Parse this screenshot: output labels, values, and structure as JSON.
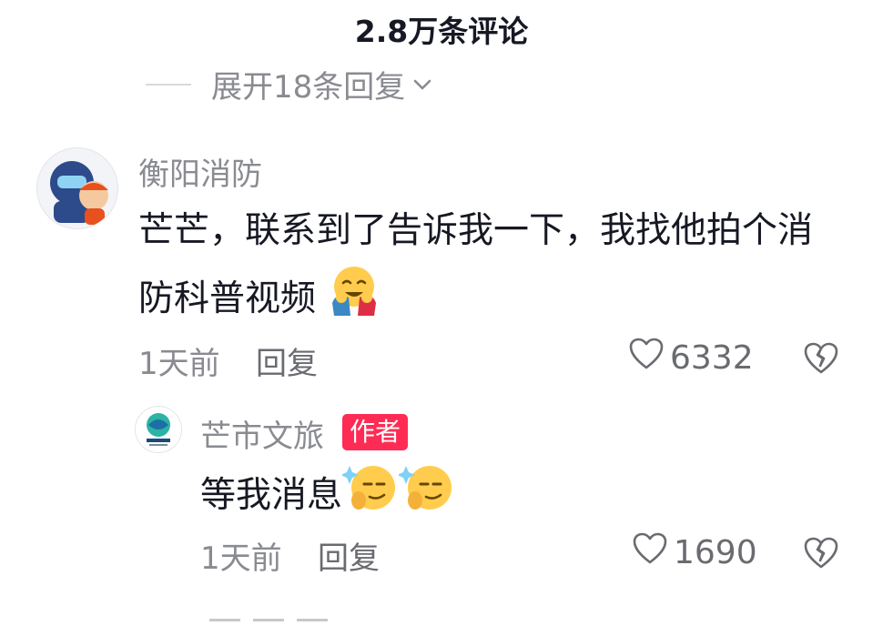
{
  "header": {
    "title": "2.8万条评论"
  },
  "expand": {
    "label": "展开18条回复"
  },
  "comments": [
    {
      "username": "衡阳消防",
      "text": "芒芒，联系到了告诉我一下，我找他拍个消防科普视频",
      "emoji": "hugging-face-emoji",
      "time": "1天前",
      "reply_label": "回复",
      "likes": "6332"
    },
    {
      "username": "芒市文旅",
      "badge": "作者",
      "text": "等我消息",
      "emoji": "smirk-sparkle-emoji",
      "time": "1天前",
      "reply_label": "回复",
      "likes": "1690"
    }
  ],
  "colors": {
    "text_primary": "#161823",
    "text_secondary": "#8a8b91",
    "author_badge": "#fe2c55"
  }
}
